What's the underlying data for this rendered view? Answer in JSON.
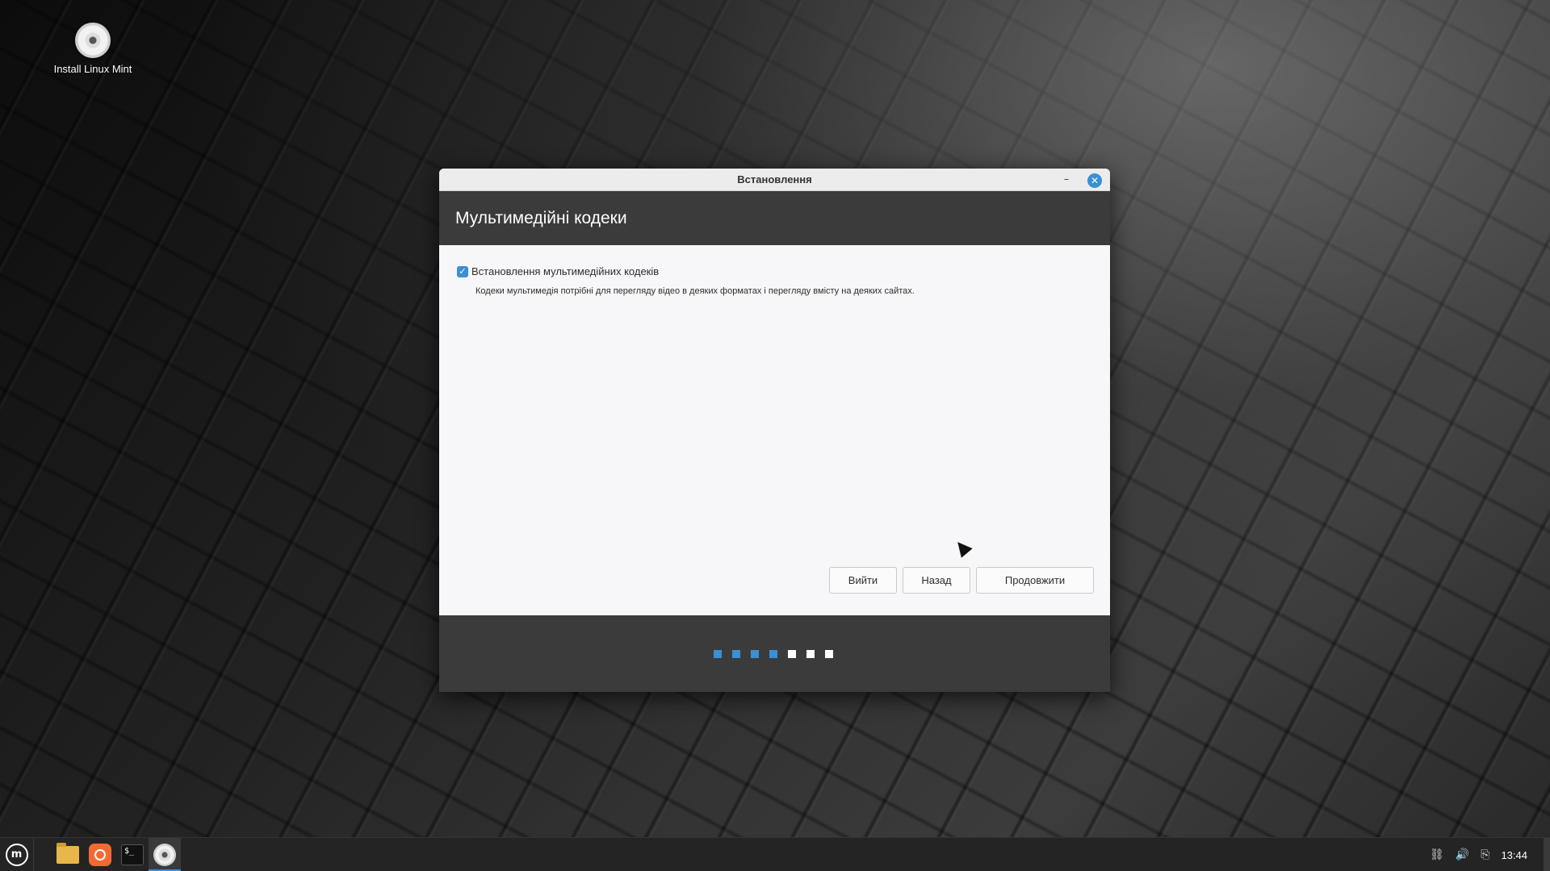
{
  "desktop": {
    "icon_label": "Install Linux Mint",
    "icon_name": "disc-icon"
  },
  "window": {
    "title": "Встановлення",
    "minimize_glyph": "–",
    "close_glyph": "✕",
    "header_title": "Мультимедійні кодеки",
    "checkbox_checked": true,
    "checkbox_glyph": "✓",
    "checkbox_label": "Встановлення мультимедійних кодеків",
    "description": "Кодеки мультимедія потрібні для перегляду відео в деяких форматах і перегляду вмісту на деяких сайтах.",
    "buttons": {
      "quit": "Вийти",
      "back": "Назад",
      "next": "Продовжити"
    },
    "progress": {
      "completed_steps": 4,
      "total_steps": 7,
      "active_color": "#3a8fd6",
      "inactive_color": "#ffffff"
    }
  },
  "taskbar": {
    "menu_logo": "m",
    "apps": [
      {
        "name": "files-folder-icon"
      },
      {
        "name": "firefox-icon"
      },
      {
        "name": "terminal-icon",
        "glyph": "$_"
      },
      {
        "name": "installer-disc-icon",
        "active": true
      }
    ],
    "tray": {
      "network_glyph": "⛓",
      "volume_glyph": "🔊",
      "clipboard_glyph": "⎘",
      "clock": "13:44"
    }
  },
  "accent_color": "#3a8fd6"
}
